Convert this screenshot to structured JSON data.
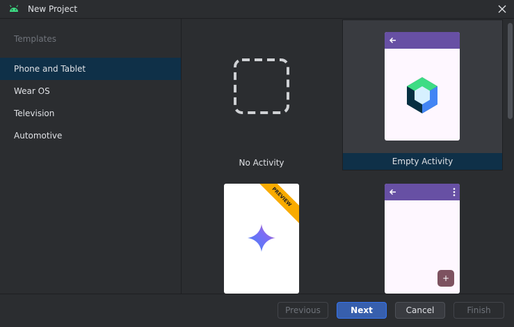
{
  "window": {
    "title": "New Project"
  },
  "sidebar": {
    "heading": "Templates",
    "items": [
      {
        "label": "Phone and Tablet"
      },
      {
        "label": "Wear OS"
      },
      {
        "label": "Television"
      },
      {
        "label": "Automotive"
      }
    ]
  },
  "templates": [
    {
      "label": "No Activity"
    },
    {
      "label": "Empty Activity"
    },
    {
      "badge": "PREVIEW"
    },
    {
      "fab_symbol": "+"
    }
  ],
  "footer": {
    "previous": "Previous",
    "next": "Next",
    "cancel": "Cancel",
    "finish": "Finish"
  },
  "colors": {
    "selection": "#0f3048",
    "phone_bar": "#6750a4",
    "preview_ribbon": "#f9ab00",
    "compose_green": "#3ddc84"
  }
}
